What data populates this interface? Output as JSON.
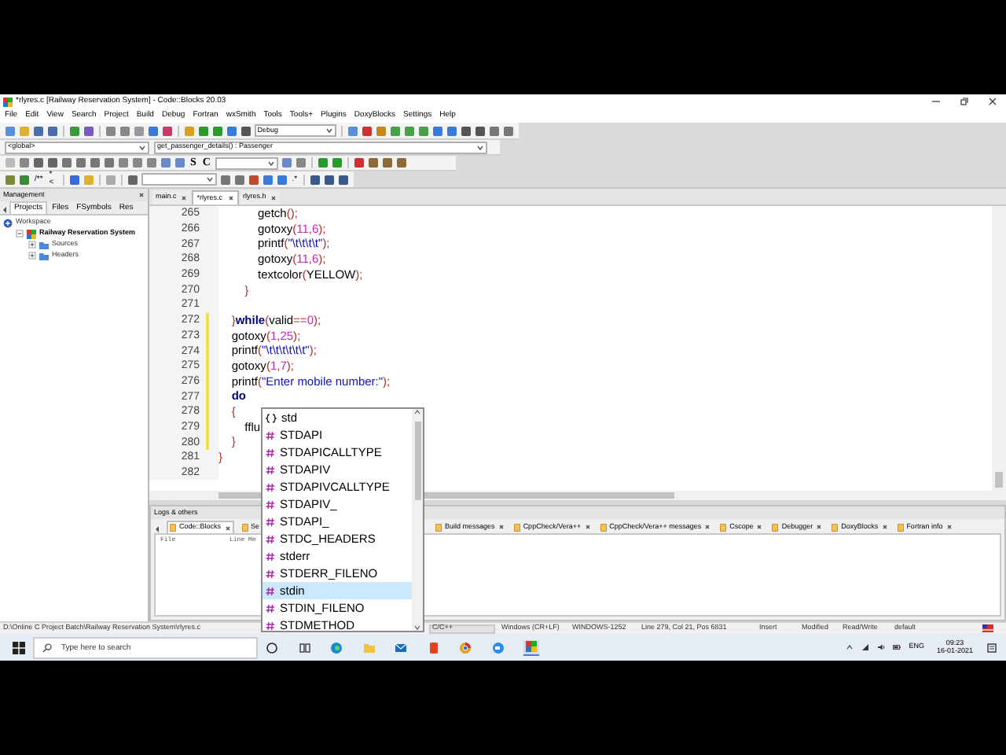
{
  "window": {
    "title": "*rlyres.c [Railway Reservation System] - Code::Blocks 20.03"
  },
  "menu": [
    "File",
    "Edit",
    "View",
    "Search",
    "Project",
    "Build",
    "Debug",
    "Fortran",
    "wxSmith",
    "Tools",
    "Tools+",
    "Plugins",
    "DoxyBlocks",
    "Settings",
    "Help"
  ],
  "toolbar_1": {
    "build_target": "Debug"
  },
  "toolbar_2": {
    "scope": "<global>",
    "function": "get_passenger_details() : Passenger"
  },
  "toolbar_3": {
    "buttons": [
      "S",
      "C"
    ]
  },
  "toolbar_4": {
    "buttons": [
      "/**",
      "*<",
      ".*"
    ]
  },
  "management": {
    "title": "Management",
    "tabs": [
      {
        "label": "Projects",
        "selected": true
      },
      {
        "label": "Files",
        "selected": false
      },
      {
        "label": "FSymbols",
        "selected": false
      },
      {
        "label": "Res",
        "selected": false
      }
    ],
    "tree": [
      {
        "label": "Workspace",
        "kind": "workspace",
        "children": [
          {
            "label": "Railway Reservation System",
            "kind": "project",
            "expanded": true,
            "children": [
              {
                "label": "Sources",
                "kind": "folder",
                "expanded": false
              },
              {
                "label": "Headers",
                "kind": "folder",
                "expanded": false
              }
            ]
          }
        ]
      }
    ]
  },
  "editor": {
    "tabs": [
      {
        "label": "main.c",
        "selected": false
      },
      {
        "label": "*rlyres.c",
        "selected": true
      },
      {
        "label": "rlyres.h",
        "selected": false
      }
    ],
    "lines": [
      {
        "number": "265",
        "changed": false,
        "code": [
          {
            "kind": "id",
            "text": "            getch"
          },
          {
            "kind": "punct",
            "text": "();"
          }
        ]
      },
      {
        "number": "266",
        "changed": false,
        "code": [
          {
            "kind": "id",
            "text": "            gotoxy"
          },
          {
            "kind": "punct",
            "text": "("
          },
          {
            "kind": "num",
            "text": "11"
          },
          {
            "kind": "punct",
            "text": ","
          },
          {
            "kind": "num",
            "text": "6"
          },
          {
            "kind": "punct",
            "text": ");"
          }
        ]
      },
      {
        "number": "267",
        "changed": false,
        "code": [
          {
            "kind": "id",
            "text": "            printf"
          },
          {
            "kind": "punct",
            "text": "("
          },
          {
            "kind": "str",
            "text": "\"\\t\\t\\t\\t\""
          },
          {
            "kind": "punct",
            "text": ");"
          }
        ]
      },
      {
        "number": "268",
        "changed": false,
        "code": [
          {
            "kind": "id",
            "text": "            gotoxy"
          },
          {
            "kind": "punct",
            "text": "("
          },
          {
            "kind": "num",
            "text": "11"
          },
          {
            "kind": "punct",
            "text": ","
          },
          {
            "kind": "num",
            "text": "6"
          },
          {
            "kind": "punct",
            "text": ");"
          }
        ]
      },
      {
        "number": "269",
        "changed": false,
        "code": [
          {
            "kind": "id",
            "text": "            textcolor"
          },
          {
            "kind": "punct",
            "text": "("
          },
          {
            "kind": "id",
            "text": "YELLOW"
          },
          {
            "kind": "punct",
            "text": ");"
          }
        ]
      },
      {
        "number": "270",
        "changed": false,
        "code": [
          {
            "kind": "punct",
            "text": "        }"
          }
        ]
      },
      {
        "number": "271",
        "changed": false
      },
      {
        "number": "272",
        "changed": true,
        "code": [
          {
            "kind": "punct",
            "text": "    }"
          },
          {
            "kind": "kw",
            "text": "while"
          },
          {
            "kind": "punct",
            "text": "("
          },
          {
            "kind": "id",
            "text": "valid"
          },
          {
            "kind": "punct",
            "text": "=="
          },
          {
            "kind": "num",
            "text": "0"
          },
          {
            "kind": "punct",
            "text": ");"
          }
        ]
      },
      {
        "number": "273",
        "changed": true,
        "code": [
          {
            "kind": "id",
            "text": "    gotoxy"
          },
          {
            "kind": "punct",
            "text": "("
          },
          {
            "kind": "num",
            "text": "1"
          },
          {
            "kind": "punct",
            "text": ","
          },
          {
            "kind": "num",
            "text": "25"
          },
          {
            "kind": "punct",
            "text": ");"
          }
        ]
      },
      {
        "number": "274",
        "changed": true,
        "code": [
          {
            "kind": "id",
            "text": "    printf"
          },
          {
            "kind": "punct",
            "text": "("
          },
          {
            "kind": "str",
            "text": "\"\\t\\t\\t\\t\\t\\t\""
          },
          {
            "kind": "punct",
            "text": ");"
          }
        ]
      },
      {
        "number": "275",
        "changed": true,
        "code": [
          {
            "kind": "id",
            "text": "    gotoxy"
          },
          {
            "kind": "punct",
            "text": "("
          },
          {
            "kind": "num",
            "text": "1"
          },
          {
            "kind": "punct",
            "text": ","
          },
          {
            "kind": "num",
            "text": "7"
          },
          {
            "kind": "punct",
            "text": ");"
          }
        ]
      },
      {
        "number": "276",
        "changed": true,
        "code": [
          {
            "kind": "id",
            "text": "    printf"
          },
          {
            "kind": "punct",
            "text": "("
          },
          {
            "kind": "str",
            "text": "\"Enter mobile number:\""
          },
          {
            "kind": "punct",
            "text": ");"
          }
        ]
      },
      {
        "number": "277",
        "changed": true,
        "code": [
          {
            "kind": "kw",
            "text": "    do"
          }
        ]
      },
      {
        "number": "278",
        "changed": true,
        "code": [
          {
            "kind": "punct",
            "text": "    {"
          }
        ]
      },
      {
        "number": "279",
        "changed": true,
        "code": [
          {
            "kind": "id",
            "text": "        fflu"
          }
        ]
      },
      {
        "number": "280",
        "changed": true,
        "code": [
          {
            "kind": "punct",
            "text": "    }"
          }
        ]
      },
      {
        "number": "281",
        "changed": false,
        "code": [
          {
            "kind": "punct",
            "text": "}"
          }
        ]
      },
      {
        "number": "282",
        "changed": false
      }
    ]
  },
  "autocomplete": {
    "items": [
      {
        "label": "std",
        "kind": "namespace",
        "selected": false
      },
      {
        "label": "STDAPI",
        "kind": "macro",
        "selected": false
      },
      {
        "label": "STDAPICALLTYPE",
        "kind": "macro",
        "selected": false
      },
      {
        "label": "STDAPIV",
        "kind": "macro",
        "selected": false
      },
      {
        "label": "STDAPIVCALLTYPE",
        "kind": "macro",
        "selected": false
      },
      {
        "label": "STDAPIV_",
        "kind": "macro",
        "selected": false
      },
      {
        "label": "STDAPI_",
        "kind": "macro",
        "selected": false
      },
      {
        "label": "STDC_HEADERS",
        "kind": "macro",
        "selected": false
      },
      {
        "label": "stderr",
        "kind": "macro",
        "selected": false
      },
      {
        "label": "STDERR_FILENO",
        "kind": "macro",
        "selected": false
      },
      {
        "label": "stdin",
        "kind": "macro",
        "selected": true
      },
      {
        "label": "STDIN_FILENO",
        "kind": "macro",
        "selected": false
      },
      {
        "label": "STDMETHOD",
        "kind": "macro",
        "selected": false
      }
    ]
  },
  "logs": {
    "title": "Logs & others",
    "tabs_left": [
      {
        "label": "Code::Blocks",
        "selected": true
      },
      {
        "label": "Se",
        "selected": false
      }
    ],
    "tabs_right": [
      {
        "label": "Build messages",
        "selected": false
      },
      {
        "label": "CppCheck/Vera++",
        "selected": false
      },
      {
        "label": "CppCheck/Vera++ messages",
        "selected": false
      },
      {
        "label": "Cscope",
        "selected": false
      },
      {
        "label": "Debugger",
        "selected": false
      },
      {
        "label": "DoxyBlocks",
        "selected": false
      },
      {
        "label": "Fortran info",
        "selected": false
      }
    ],
    "columns": [
      "File",
      "Line",
      "Me"
    ]
  },
  "status_bar": {
    "path": "D:\\Online C Project Batch\\Railway Reservation System\\rlyres.c",
    "fields": [
      "C/C++",
      "Windows (CR+LF)",
      "WINDOWS-1252",
      "Line 279, Col 21, Pos 6831",
      "Insert",
      "Modified",
      "Read/Write",
      "default"
    ]
  },
  "taskbar": {
    "search_placeholder": "Type here to search",
    "language": "ENG",
    "time": "09:23",
    "date": "16-01-2021"
  }
}
